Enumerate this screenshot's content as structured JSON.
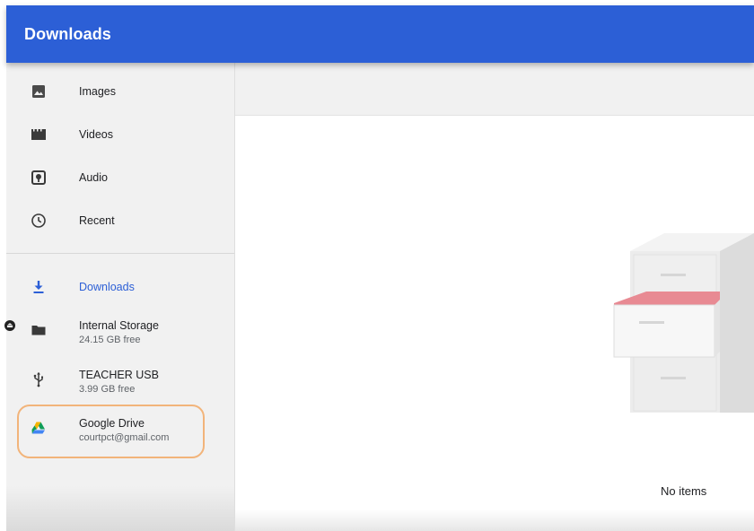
{
  "app": {
    "title": "Downloads"
  },
  "sidebar": {
    "items": [
      {
        "label": "Images",
        "icon": "image-icon"
      },
      {
        "label": "Videos",
        "icon": "video-icon"
      },
      {
        "label": "Audio",
        "icon": "audio-icon"
      },
      {
        "label": "Recent",
        "icon": "clock-icon"
      },
      {
        "label": "Downloads",
        "icon": "download-icon",
        "active": true
      },
      {
        "label": "Internal Storage",
        "sub": "24.15 GB free",
        "icon": "folder-icon"
      },
      {
        "label": "TEACHER USB",
        "sub": "3.99 GB free",
        "icon": "usb-icon"
      },
      {
        "label": "Google Drive",
        "sub": "courtpct@gmail.com",
        "icon": "google-drive-icon",
        "highlighted": true
      }
    ]
  },
  "main": {
    "empty_text": "No items"
  },
  "colors": {
    "appbar": "#2c5fd6",
    "active": "#2c5fd6",
    "highlight_ring": "#f2b47a",
    "drawer_accent": "#e88a93"
  }
}
